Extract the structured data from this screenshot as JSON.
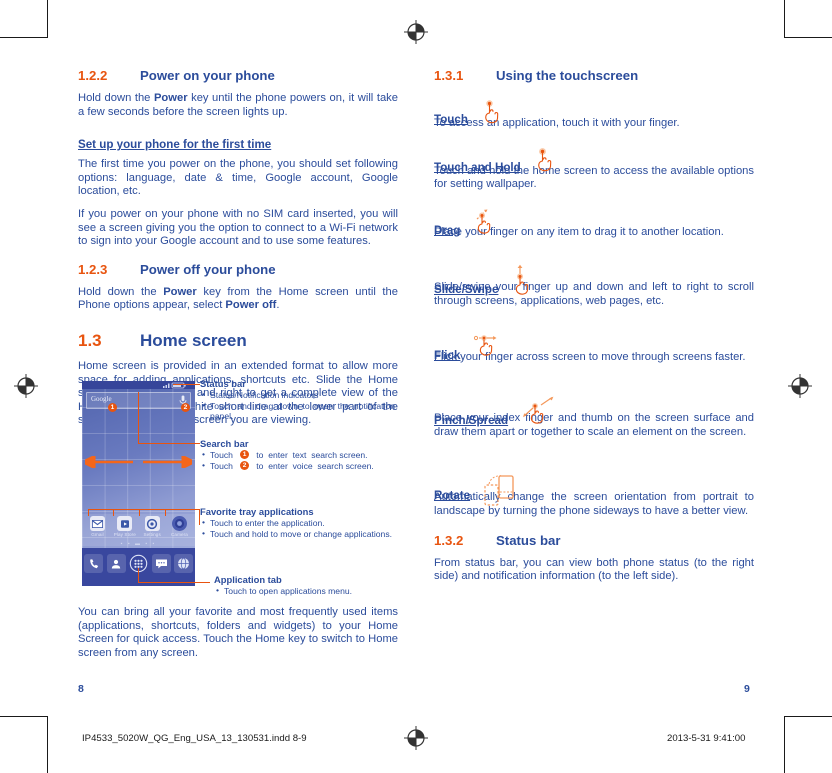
{
  "document": {
    "colors": {
      "heading_blue": "#2B4C9B",
      "accent_orange": "#E8540F",
      "body_blue": "#2B4C9B"
    }
  },
  "left_page": {
    "folio": "8",
    "sections": [
      {
        "number": "1.2.2",
        "title": "Power on your phone",
        "paragraphs": [
          "Hold down the Power key until the phone powers on, it will take a few seconds before the screen lights up."
        ]
      },
      {
        "number": "1.2.3",
        "title": "Power off your phone",
        "paragraphs": [
          "Hold down the Power key from the Home screen until the Phone options appear, select Power off."
        ]
      },
      {
        "number": "1.3",
        "title": "Home screen",
        "paragraphs": [
          "Home screen is provided in an extended format to allow more space for adding applications, shortcuts etc. Slide the Home screen horizontally left and right to get a complete view of the Home screens. The white short line at the lower part of the screen indicates which screen you are viewing."
        ]
      }
    ],
    "subheading_first_time": "Set up your phone for the first time",
    "first_time_paragraphs": [
      "The first time you power on the phone, you should set following options: language, date & time, Google account, Google location, etc.",
      "If you power on your phone with no SIM card inserted, you will see a screen giving you the option to connect to a Wi-Fi network to sign into your Google account and to use some features."
    ],
    "closing_paragraph": "You can bring all your favorite and most frequently used items (applications, shortcuts, folders and widgets) to your Home Screen for quick access. Touch the Home key to switch to Home screen from any screen.",
    "slug": "IP4533_5020W_QG_Eng_USA_13_130531.indd   8-9"
  },
  "figure": {
    "search_bar_text": "Google",
    "page_dots": "▪ ▪ ▬ ▪ ▪",
    "tray_apps": [
      {
        "label": "Gmail",
        "icon": "gmail-icon"
      },
      {
        "label": "Play Store",
        "icon": "play-store-icon"
      },
      {
        "label": "Settings",
        "icon": "settings-gear-icon"
      },
      {
        "label": "Camera",
        "icon": "camera-icon"
      }
    ],
    "dock_apps": [
      {
        "label": "Phone",
        "icon": "phone-handset-icon"
      },
      {
        "label": "Contacts",
        "icon": "contacts-person-icon"
      },
      {
        "label": "Application tab",
        "icon": "app-drawer-icon"
      },
      {
        "label": "Messaging",
        "icon": "messaging-bubble-icon"
      },
      {
        "label": "Browser",
        "icon": "browser-globe-icon"
      }
    ],
    "marker_one": "1",
    "marker_two": "2"
  },
  "callouts": [
    {
      "title": "Status bar",
      "items": [
        "Status/Notification indicators",
        "Touch and drag down to open the notification panel."
      ]
    },
    {
      "title": "Search bar",
      "items": [
        "Touch ① to enter text search screen.",
        "Touch ② to enter voice search screen."
      ]
    },
    {
      "title": "Favorite tray applications",
      "items": [
        "Touch to enter the application.",
        "Touch and hold to move or change applications."
      ]
    },
    {
      "title": "Application tab",
      "items": [
        "Touch to open applications menu."
      ]
    }
  ],
  "right_page": {
    "folio": "9",
    "sections": [
      {
        "number": "1.3.1",
        "title": "Using the touchscreen"
      },
      {
        "number": "1.3.2",
        "title": "Status bar",
        "paragraph": "From status bar, you can view both phone status (to the right side) and notification information (to the left side)."
      }
    ],
    "gestures": [
      {
        "label": "Touch",
        "icon": "hand-touch-icon",
        "description": "To access an application, touch it with your finger."
      },
      {
        "label": "Touch and Hold",
        "icon": "hand-touch-hold-icon",
        "description": "Touch and hold the home screen to access the available options for setting wallpaper."
      },
      {
        "label": "Drag",
        "icon": "hand-drag-icon",
        "description": "Place your finger on any item to drag it to another location."
      },
      {
        "label": "Slide/Swipe",
        "icon": "hand-slide-swipe-icon",
        "description": "Slide/swipe your finger up and down and left to right to scroll through screens, applications, web pages, etc."
      },
      {
        "label": "Flick",
        "icon": "hand-flick-icon",
        "description": "Flick your finger across screen to move through screens faster."
      },
      {
        "label": "Pinch/Spread",
        "icon": "hand-pinch-spread-icon",
        "description": "Place your index finger and thumb on the screen surface and draw them apart or together to scale an element on the screen."
      },
      {
        "label": "Rotate",
        "icon": "phone-rotate-icon",
        "description": "Automatically change the screen orientation from portrait to landscape by turning the phone sideways to have a better view."
      }
    ],
    "slug": "2013-5-31   9:41:00"
  }
}
